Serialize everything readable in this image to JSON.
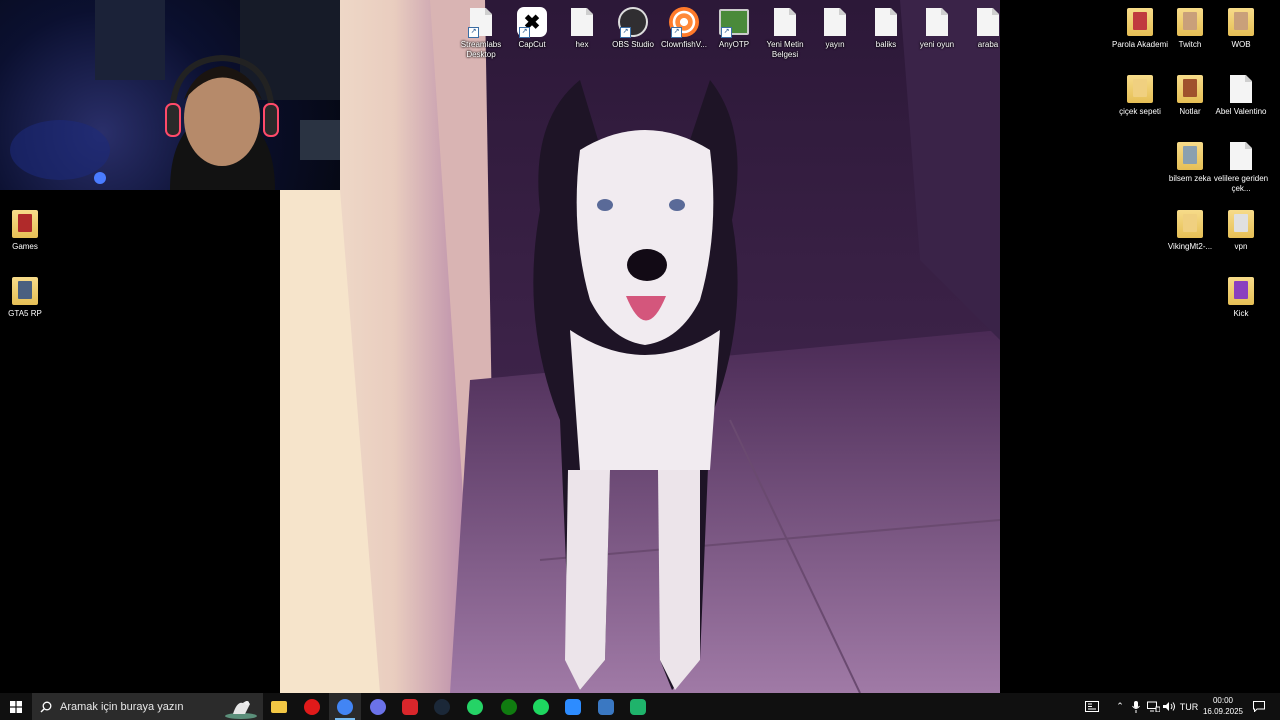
{
  "desktop_icons": [
    {
      "id": "streamlabs",
      "label": "Streamlabs Desktop",
      "kind": "file",
      "shortcut": true
    },
    {
      "id": "capcut",
      "label": "CapCut",
      "kind": "capcut",
      "shortcut": true
    },
    {
      "id": "hex",
      "label": "hex",
      "kind": "file"
    },
    {
      "id": "obs",
      "label": "OBS Studio",
      "kind": "obs",
      "shortcut": true
    },
    {
      "id": "clownfish",
      "label": "ClownfishV...",
      "kind": "clownfish",
      "shortcut": true
    },
    {
      "id": "anyotp",
      "label": "AnyOTP",
      "kind": "anyotp",
      "shortcut": true
    },
    {
      "id": "yeni-metin",
      "label": "Yeni Metin Belgesi",
      "kind": "file"
    },
    {
      "id": "yayin",
      "label": "yayın",
      "kind": "file"
    },
    {
      "id": "baliks",
      "label": "baliks",
      "kind": "file"
    },
    {
      "id": "yeni-oyun",
      "label": "yeni oyun",
      "kind": "file"
    },
    {
      "id": "araba",
      "label": "araba",
      "kind": "file"
    },
    {
      "id": "parola",
      "label": "Parola Akademi",
      "kind": "folder",
      "accent": "#c0393f"
    },
    {
      "id": "twitch",
      "label": "Twitch",
      "kind": "folder",
      "accent": "#c9a07a"
    },
    {
      "id": "wob",
      "label": "WOB",
      "kind": "folder",
      "accent": "#c9a07a"
    },
    {
      "id": "cicek",
      "label": "çiçek sepeti",
      "kind": "folder",
      "accent": "#f0d080"
    },
    {
      "id": "notlar",
      "label": "Notlar",
      "kind": "folder",
      "accent": "#a0522d"
    },
    {
      "id": "abel",
      "label": "Abel Valentino",
      "kind": "file"
    },
    {
      "id": "bilsem",
      "label": "bilsem zeka",
      "kind": "folder",
      "accent": "#8aa0b0"
    },
    {
      "id": "velilere",
      "label": "velilere geriden çek...",
      "kind": "file"
    },
    {
      "id": "vikingmt2",
      "label": "VikingMt2-...",
      "kind": "folder",
      "accent": "#f0d080"
    },
    {
      "id": "vpn",
      "label": "vpn",
      "kind": "folder",
      "accent": "#e0e0e0"
    },
    {
      "id": "kick",
      "label": "Kick",
      "kind": "folder",
      "accent": "#8a3fbf"
    },
    {
      "id": "games",
      "label": "Games",
      "kind": "folder",
      "accent": "#b02a2a"
    },
    {
      "id": "gta5rp",
      "label": "GTA5 RP",
      "kind": "folder",
      "accent": "#4a6080"
    }
  ],
  "taskbar": {
    "search_placeholder": "Aramak için buraya yazın",
    "apps": [
      {
        "id": "file-explorer",
        "icon": "folder-icon",
        "color": "#f2c744"
      },
      {
        "id": "opera",
        "icon": "opera-icon",
        "color": "#e01a1a"
      },
      {
        "id": "chrome",
        "icon": "chrome-icon",
        "color": "#4285f4",
        "active": true
      },
      {
        "id": "discord-app",
        "icon": "discord-icon",
        "color": "#6b72e8"
      },
      {
        "id": "red-app",
        "icon": "red-app-icon",
        "color": "#d9262b"
      },
      {
        "id": "steam",
        "icon": "steam-icon",
        "color": "#1b2838"
      },
      {
        "id": "whatsapp",
        "icon": "whatsapp-icon",
        "color": "#25d366"
      },
      {
        "id": "xbox",
        "icon": "xbox-icon",
        "color": "#107c10"
      },
      {
        "id": "spotify",
        "icon": "spotify-icon",
        "color": "#1ed760"
      },
      {
        "id": "zoom",
        "icon": "zoom-icon",
        "color": "#2d8cff"
      },
      {
        "id": "settings-app",
        "icon": "gear-icon",
        "color": "#3a78c2"
      },
      {
        "id": "green-app",
        "icon": "green-app-icon",
        "color": "#1fb36b"
      }
    ],
    "tray": {
      "language": "TUR",
      "time": "00:00",
      "date": "16.09.2025"
    }
  }
}
